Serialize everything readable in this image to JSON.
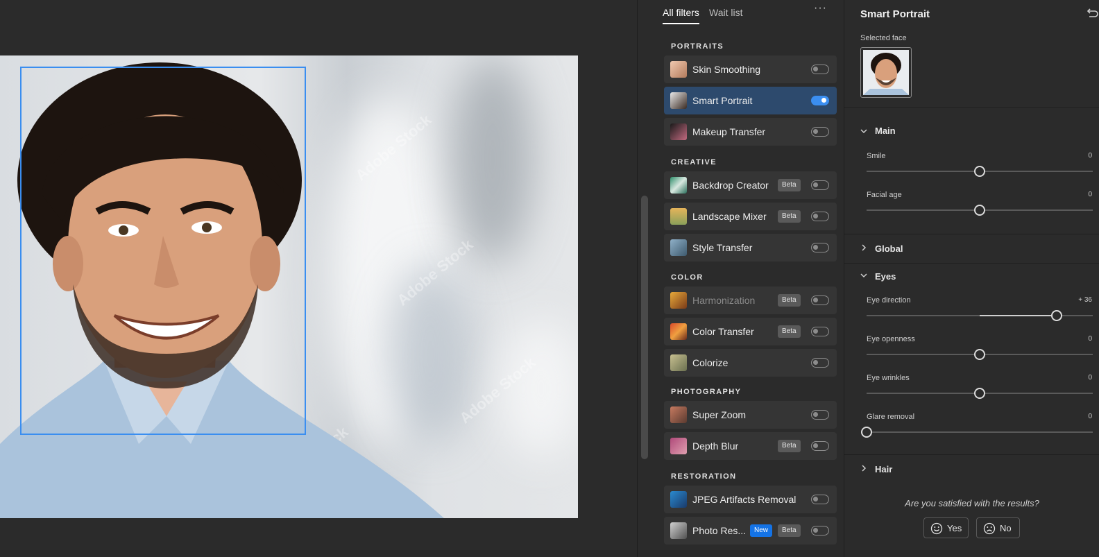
{
  "canvas": {
    "watermark_text": "Adobe Stock"
  },
  "filters": {
    "tabs": [
      {
        "label": "All filters",
        "active": true
      },
      {
        "label": "Wait list",
        "active": false
      }
    ],
    "more_label": "···",
    "sections": [
      {
        "title": "PORTRAITS"
      },
      {
        "title": "CREATIVE"
      },
      {
        "title": "COLOR"
      },
      {
        "title": "PHOTOGRAPHY"
      },
      {
        "title": "RESTORATION"
      }
    ],
    "items": [
      {
        "name": "Skin Smoothing",
        "enabled": false
      },
      {
        "name": "Smart Portrait",
        "enabled": true
      },
      {
        "name": "Makeup Transfer",
        "enabled": false
      },
      {
        "name": "Backdrop Creator",
        "badge": "Beta",
        "enabled": false
      },
      {
        "name": "Landscape Mixer",
        "badge": "Beta",
        "enabled": false
      },
      {
        "name": "Style Transfer",
        "enabled": false
      },
      {
        "name": "Harmonization",
        "badge": "Beta",
        "enabled": false
      },
      {
        "name": "Color Transfer",
        "badge": "Beta",
        "enabled": false
      },
      {
        "name": "Colorize",
        "enabled": false
      },
      {
        "name": "Super Zoom",
        "enabled": false
      },
      {
        "name": "Depth Blur",
        "badge": "Beta",
        "enabled": false
      },
      {
        "name": "JPEG Artifacts Removal",
        "enabled": false
      },
      {
        "name": "Photo Res...",
        "badge_new": "New",
        "badge": "Beta",
        "enabled": false
      }
    ]
  },
  "props": {
    "title": "Smart Portrait",
    "selected_face_label": "Selected face",
    "groups": [
      {
        "name": "Main",
        "expanded": true
      },
      {
        "name": "Global",
        "expanded": false
      },
      {
        "name": "Eyes",
        "expanded": true
      },
      {
        "name": "Hair",
        "expanded": false
      }
    ],
    "sliders": [
      {
        "label": "Smile",
        "value": "0",
        "level": 0.5,
        "bipolar": true
      },
      {
        "label": "Facial age",
        "value": "0",
        "level": 0.5,
        "bipolar": true
      },
      {
        "label": "Eye direction",
        "value": "+ 36",
        "level": 0.84,
        "bipolar": true
      },
      {
        "label": "Eye openness",
        "value": "0",
        "level": 0.5,
        "bipolar": true
      },
      {
        "label": "Eye wrinkles",
        "value": "0",
        "level": 0.5,
        "bipolar": true
      },
      {
        "label": "Glare removal",
        "value": "0",
        "level": 0.0,
        "bipolar": false
      }
    ],
    "feedback": {
      "question": "Are you satisfied with the results?",
      "yes_label": "Yes",
      "no_label": "No"
    }
  },
  "colors": {
    "accent": "#3b8ef0",
    "new_badge": "#1473e6",
    "selected_row": "#2d4a6d",
    "panel_bg": "#2b2b2b"
  }
}
